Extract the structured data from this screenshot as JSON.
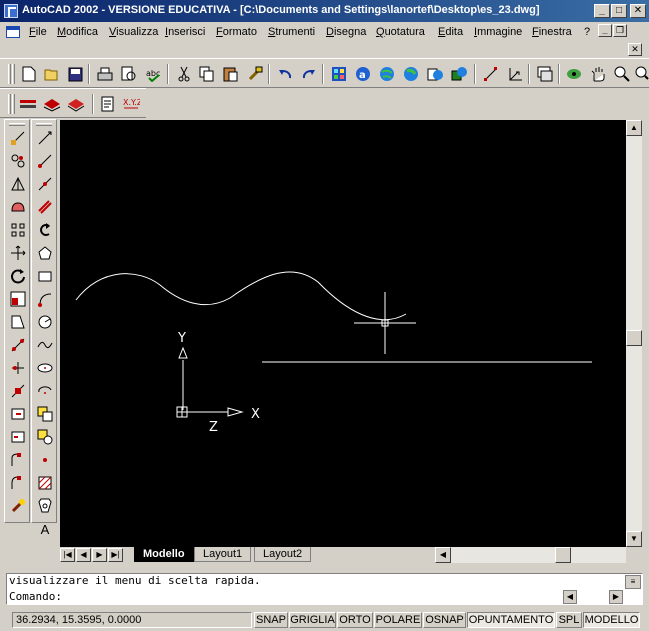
{
  "window": {
    "title": "AutoCAD 2002 - VERSIONE EDUCATIVA - [C:\\Documents and Settings\\lanortef\\Desktop\\es_23.dwg]",
    "minimize": "_",
    "maximize": "□",
    "close": "✕"
  },
  "menu": {
    "items": [
      "File",
      "Modifica",
      "Visualizza",
      "Inserisci",
      "Formato",
      "Strumenti",
      "Disegna",
      "Quotatura",
      "Edita",
      "Immagine",
      "Finestra",
      "?"
    ],
    "doc_minimize": "_",
    "doc_restore": "❐",
    "doc_close": "✕"
  },
  "toolbar_standard": {
    "icons": [
      "new-icon",
      "open-icon",
      "save-icon",
      "print-icon",
      "print-preview-icon",
      "spellcheck-icon",
      "cut-icon",
      "copy-icon",
      "paste-icon",
      "match-properties-icon",
      "undo-icon",
      "redo-icon",
      "design-center-icon",
      "autocad-today-icon",
      "web-icon",
      "publish-icon",
      "hyperlink-icon",
      "snap-from-icon",
      "ucs-icon",
      "aerial-view-icon",
      "named-views-icon",
      "pan-icon",
      "zoom-icon"
    ]
  },
  "toolbar_properties": {
    "icons": [
      "layer-icon",
      "layer-previous-icon",
      "layer-manager-icon",
      "properties-icon",
      "xref-icon"
    ]
  },
  "draw_toolbar": {
    "icons": [
      "line-icon",
      "construction-line-icon",
      "polyline-icon",
      "polygon-icon",
      "rectangle-icon",
      "arc-icon",
      "circle-icon",
      "revision-cloud-icon",
      "spline-icon",
      "ellipse-icon",
      "ellipse-arc-icon",
      "insert-block-icon",
      "make-block-icon",
      "point-icon",
      "hatch-icon",
      "region-icon",
      "table-icon",
      "multiline-text-icon"
    ]
  },
  "modify_toolbar": {
    "icons": [
      "erase-icon",
      "copy-object-icon",
      "mirror-icon",
      "offset-icon",
      "array-icon",
      "move-icon",
      "rotate-icon",
      "scale-icon",
      "stretch-icon",
      "trim-icon",
      "extend-icon",
      "break-icon",
      "join-icon",
      "chamfer-icon",
      "fillet-icon",
      "explode-icon"
    ]
  },
  "canvas": {
    "ucs_y": "Y",
    "ucs_x": "X",
    "ucs_z": "Z"
  },
  "tabs": {
    "items": [
      "Modello",
      "Layout1",
      "Layout2"
    ],
    "active": "Modello"
  },
  "command": {
    "history": "visualizzare il menu di scelta rapida.",
    "prompt": "Comando:"
  },
  "status": {
    "coordinates": "36.2934, 15.3595, 0.0000",
    "buttons": [
      {
        "label": "SNAP",
        "on": false
      },
      {
        "label": "GRIGLIA",
        "on": false
      },
      {
        "label": "ORTO",
        "on": false
      },
      {
        "label": "POLARE",
        "on": false
      },
      {
        "label": "OSNAP",
        "on": false
      },
      {
        "label": "OPUNTAMENTO",
        "on": true
      },
      {
        "label": "SPL",
        "on": false
      },
      {
        "label": "MODELLO",
        "on": true
      }
    ]
  }
}
